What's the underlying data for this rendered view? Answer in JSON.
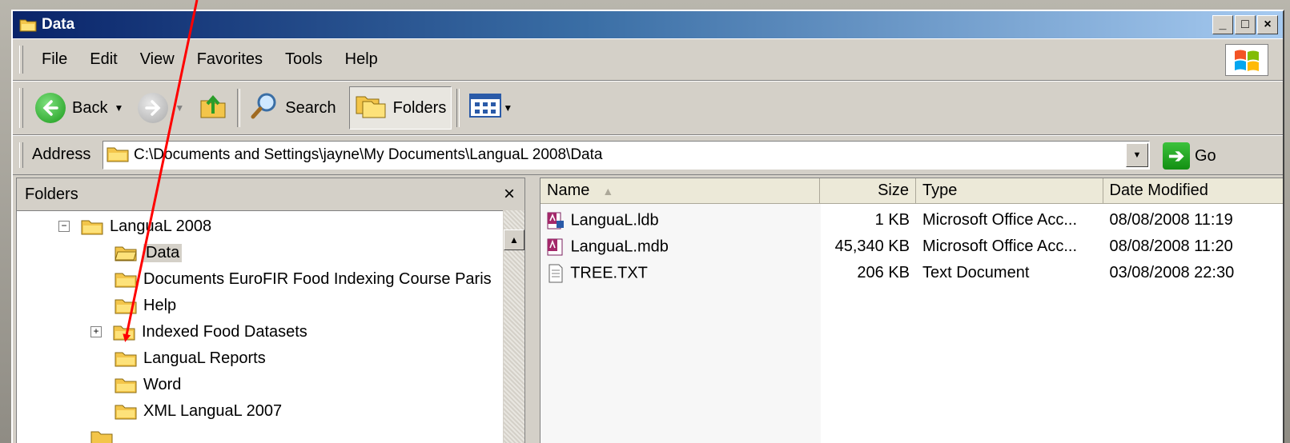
{
  "window": {
    "title": "Data"
  },
  "window_controls": {
    "minimize": "_",
    "maximize": "□",
    "close": "×"
  },
  "menu": [
    "File",
    "Edit",
    "View",
    "Favorites",
    "Tools",
    "Help"
  ],
  "toolbar": {
    "back_label": "Back",
    "search_label": "Search",
    "folders_label": "Folders"
  },
  "address": {
    "label": "Address",
    "value": "C:\\Documents and Settings\\jayne\\My Documents\\LanguaL 2008\\Data",
    "go_label": "Go"
  },
  "folders_pane": {
    "title": "Folders",
    "close": "×",
    "tree": [
      {
        "label": "LanguaL 2008",
        "expander": "−"
      },
      {
        "label": "Data",
        "expander": ""
      },
      {
        "label": "Documents EuroFIR Food Indexing Course Paris",
        "expander": ""
      },
      {
        "label": "Help",
        "expander": ""
      },
      {
        "label": "Indexed Food Datasets",
        "expander": "+"
      },
      {
        "label": "LanguaL Reports",
        "expander": ""
      },
      {
        "label": "Word",
        "expander": ""
      },
      {
        "label": "XML LanguaL 2007",
        "expander": ""
      }
    ]
  },
  "files_pane": {
    "columns": [
      "Name",
      "Size",
      "Type",
      "Date Modified"
    ],
    "files": [
      {
        "name": "LanguaL.ldb",
        "size": "1 KB",
        "type": "Microsoft Office Acc...",
        "date": "08/08/2008 11:19",
        "icon": "access-lock-icon"
      },
      {
        "name": "LanguaL.mdb",
        "size": "45,340 KB",
        "type": "Microsoft Office Acc...",
        "date": "08/08/2008 11:20",
        "icon": "access-db-icon"
      },
      {
        "name": "TREE.TXT",
        "size": "206 KB",
        "type": "Text Document",
        "date": "03/08/2008 22:30",
        "icon": "text-file-icon"
      }
    ]
  },
  "colors": {
    "title_start": "#0a246a",
    "title_end": "#a6caf0",
    "chrome": "#d4d0c8",
    "annotation_arrow": "#ff0000"
  }
}
